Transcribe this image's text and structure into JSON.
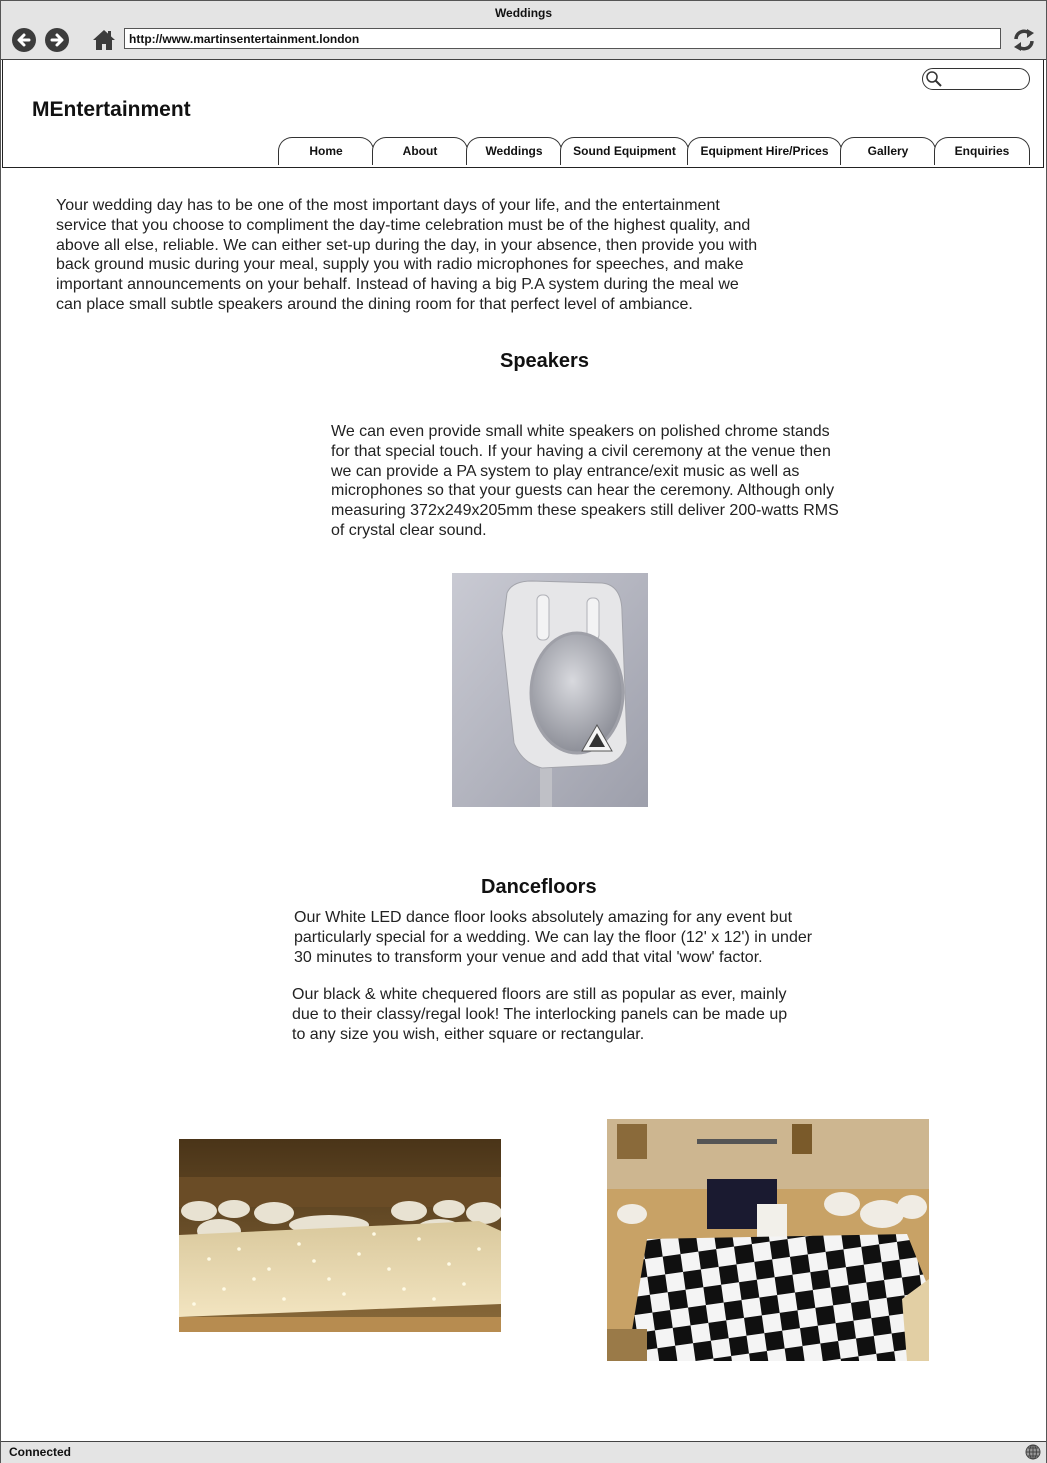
{
  "window": {
    "title": "Weddings"
  },
  "toolbar": {
    "url": "http://www.martinsentertainment.london",
    "back_icon": "arrow-left-icon",
    "forward_icon": "arrow-right-icon",
    "home_icon": "home-icon",
    "reload_icon": "refresh-icon"
  },
  "header": {
    "brand": "MEntertainment",
    "search": {
      "value": "",
      "icon": "search-icon"
    }
  },
  "nav": {
    "tabs": [
      {
        "label": "Home"
      },
      {
        "label": "About"
      },
      {
        "label": "Weddings"
      },
      {
        "label": "Sound Equipment"
      },
      {
        "label": "Equipment Hire/Prices"
      },
      {
        "label": "Gallery"
      },
      {
        "label": "Enquiries"
      }
    ]
  },
  "content": {
    "intro_lines": [
      "Your wedding day has to be one of the most important days of your life, and the entertainment",
      "service that you choose to compliment the day-time celebration must be of the highest quality, and",
      "above all else, reliable. We can either set-up during the day, in your absence, then provide you with",
      "back ground music during your meal, supply you with radio microphones for speeches, and make",
      "important announcements on your behalf. Instead of having a big P.A system during the meal we",
      "can place small subtle speakers around the dining room for that perfect level of ambiance."
    ],
    "speakers": {
      "heading": "Speakers",
      "lines": [
        "We can even provide small white speakers on polished chrome stands",
        "for that special touch. If your having a civil ceremony at the venue then",
        "we can provide a PA system to play entrance/exit music as well as",
        "microphones so that your guests can hear the ceremony. Although only",
        "measuring 372x249x205mm these speakers still deliver 200-watts RMS",
        "of crystal clear sound."
      ]
    },
    "dancefloors": {
      "heading": "Dancefloors",
      "para1_lines": [
        "Our White LED dance floor looks absolutely amazing for any event but",
        "particularly special for a wedding. We can lay the floor (12' x 12') in under",
        "30 minutes to transform your venue and add that vital 'wow' factor."
      ],
      "para2_lines": [
        "Our black & white chequered floors are still as popular as ever, mainly",
        "due to their classy/regal look! The interlocking panels can be made up",
        "to any size you wish, either square or rectangular."
      ]
    }
  },
  "statusbar": {
    "text": "Connected",
    "icon": "globe-icon"
  }
}
